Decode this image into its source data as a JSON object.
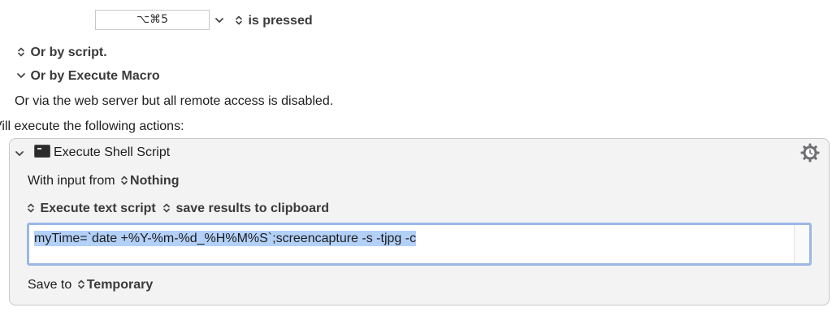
{
  "trigger": {
    "hotkey_value": "⌥⌘5",
    "hotkey_condition": "is pressed"
  },
  "or_script_label": "Or by script.",
  "or_execute_macro_label": "Or by Execute Macro",
  "web_server_note": "Or via the web server but all remote access is disabled.",
  "actions_heading": "Vill execute the following actions:",
  "action": {
    "title": "Execute Shell Script",
    "input_label": "With input from",
    "input_value": "Nothing",
    "execute_mode": "Execute text script",
    "result_mode": "save results to clipboard",
    "script": "myTime=`date +%Y-%m-%d_%H%M%S`;screencapture -s -tjpg -c",
    "save_to_label": "Save to",
    "save_to_value": "Temporary"
  }
}
